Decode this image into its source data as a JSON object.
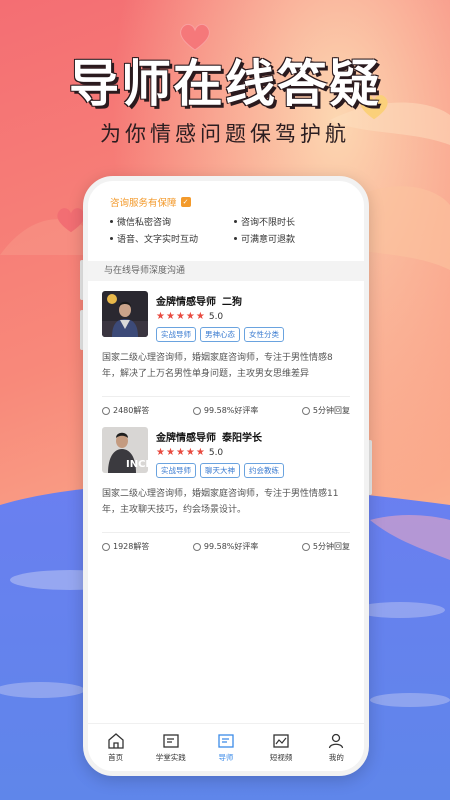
{
  "hero": {
    "title": "导师在线答疑",
    "subtitle": "为你情感问题保驾护航"
  },
  "guarantee": {
    "title": "咨询服务有保障",
    "items": [
      "微信私密咨询",
      "咨询不限时长",
      "语音、文字实时互动",
      "可满意可退款"
    ]
  },
  "section_label": "与在线导师深度沟通",
  "mentors": [
    {
      "title": "金牌情感导师",
      "name": "二狗",
      "score": "5.0",
      "stars": 5,
      "tags": [
        "实战导师",
        "男神心态",
        "女性分类"
      ],
      "desc": "国家二级心理咨询师，婚姻家庭咨询师，专注于男性情感8年，解决了上万名男性单身问题，主攻男女思维差异",
      "answers": "2480解答",
      "rating": "99.58%好评率",
      "reply": "5分钟回复"
    },
    {
      "title": "金牌情感导师",
      "name": "泰阳学长",
      "score": "5.0",
      "stars": 5,
      "tags": [
        "实战导师",
        "聊天大神",
        "约会教练"
      ],
      "desc": "国家二级心理咨询师，婚姻家庭咨询师，专注于男性情感11年，主攻聊天技巧，约会场景设计。",
      "answers": "1928解答",
      "rating": "99.58%好评率",
      "reply": "5分钟回复",
      "photo_text": "INCE"
    }
  ],
  "tabs": [
    {
      "label": "首页",
      "icon": "home-icon"
    },
    {
      "label": "学堂实践",
      "icon": "study-icon"
    },
    {
      "label": "导师",
      "icon": "mentor-icon"
    },
    {
      "label": "短视频",
      "icon": "video-icon"
    },
    {
      "label": "我的",
      "icon": "profile-icon"
    }
  ],
  "active_tab": 2,
  "colors": {
    "accent_blue": "#3c8be8",
    "star_red": "#e84a3f",
    "guarantee_orange": "#f39a2b",
    "sea_blue": "#5b7fe6"
  }
}
